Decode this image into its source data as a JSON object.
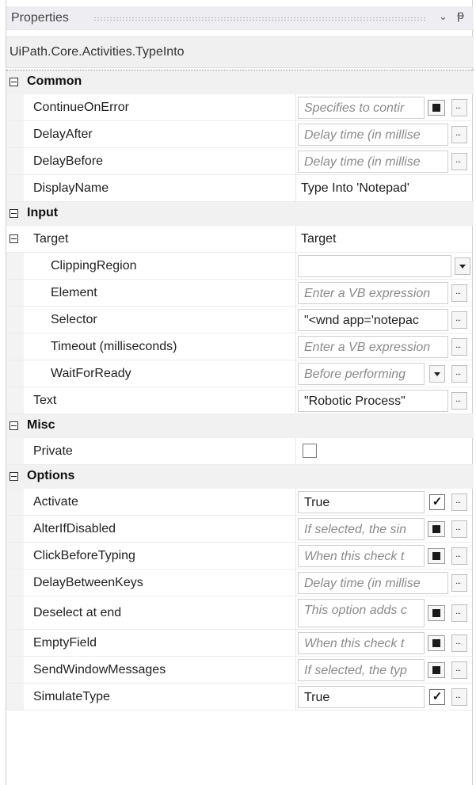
{
  "panel": {
    "title": "Properties",
    "type_name": "UiPath.Core.Activities.TypeInto"
  },
  "categories": {
    "common": "Common",
    "input": "Input",
    "misc": "Misc",
    "options": "Options"
  },
  "common": {
    "continue_on_error": {
      "name": "ContinueOnError",
      "placeholder": "Specifies to contir"
    },
    "delay_after": {
      "name": "DelayAfter",
      "placeholder": "Delay time (in millise"
    },
    "delay_before": {
      "name": "DelayBefore",
      "placeholder": "Delay time (in millise"
    },
    "display_name": {
      "name": "DisplayName",
      "value": "Type Into 'Notepad'"
    }
  },
  "input": {
    "target": {
      "name": "Target",
      "value": "Target"
    },
    "clipping_region": {
      "name": "ClippingRegion",
      "value": ""
    },
    "element": {
      "name": "Element",
      "placeholder": "Enter a VB expression"
    },
    "selector": {
      "name": "Selector",
      "value": "\"<wnd app='notepac"
    },
    "timeout": {
      "name": "Timeout (milliseconds)",
      "placeholder": "Enter a VB expression"
    },
    "wait_for_ready": {
      "name": "WaitForReady",
      "placeholder": "Before performing"
    },
    "text": {
      "name": "Text",
      "value": "\"Robotic Process\""
    }
  },
  "misc": {
    "private": {
      "name": "Private",
      "checked": false
    }
  },
  "options": {
    "activate": {
      "name": "Activate",
      "value": "True"
    },
    "alter_if_disabled": {
      "name": "AlterIfDisabled",
      "placeholder": "If selected, the sin"
    },
    "click_before_typing": {
      "name": "ClickBeforeTyping",
      "placeholder": "When this check t"
    },
    "delay_between_keys": {
      "name": "DelayBetweenKeys",
      "placeholder": "Delay time (in millise"
    },
    "deselect_at_end": {
      "name": "Deselect at end",
      "placeholder": "This option adds c"
    },
    "empty_field": {
      "name": "EmptyField",
      "placeholder": "When this check t"
    },
    "send_window_messages": {
      "name": "SendWindowMessages",
      "placeholder": "If selected, the typ"
    },
    "simulate_type": {
      "name": "SimulateType",
      "value": "True"
    }
  },
  "glyphs": {
    "dropdown": "⌄",
    "pin": "ᵽ",
    "checkmark": "✓"
  }
}
